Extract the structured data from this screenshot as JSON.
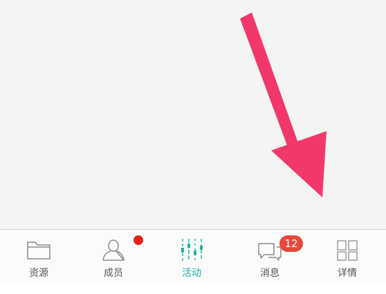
{
  "tab_bar": {
    "active": "活动",
    "tabs": [
      {
        "label": "资源",
        "icon": "folder-icon"
      },
      {
        "label": "成员",
        "icon": "person-icon",
        "dot": true
      },
      {
        "label": "活动",
        "icon": "activity-bars-icon",
        "active": true
      },
      {
        "label": "消息",
        "icon": "chat-bubbles-icon",
        "badge": "12"
      },
      {
        "label": "详情",
        "icon": "details-grid-icon"
      }
    ]
  },
  "colors": {
    "active_tab": "#1fb3a0",
    "inactive_tab": "#555555",
    "badge": "#e8483c",
    "arrow": "#f2386a",
    "dot": "#e1231a"
  }
}
